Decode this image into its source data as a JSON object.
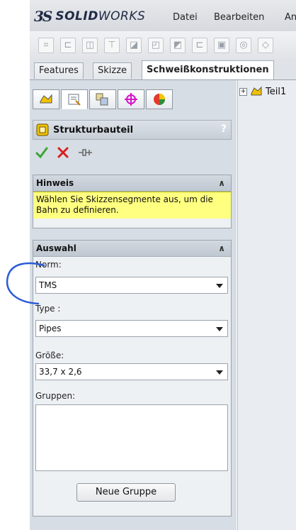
{
  "app": {
    "logo_prefix": "3S",
    "logo_name_bold": "SOLID",
    "logo_name_thin": "WORKS"
  },
  "menu": {
    "items": [
      "Datei",
      "Bearbeiten",
      "An"
    ]
  },
  "tabs": [
    {
      "label": "Features",
      "active": false
    },
    {
      "label": "Skizze",
      "active": false
    },
    {
      "label": "Schweißkonstruktionen",
      "active": true
    }
  ],
  "property_manager": {
    "title": "Strukturbauteil",
    "help": "?",
    "hint_group": {
      "title": "Hinweis",
      "text": "Wählen Sie Skizzensegmente aus, um die Bahn zu definieren."
    },
    "selection_group": {
      "title": "Auswahl",
      "norm_label": "Norm:",
      "norm_value": "TMS",
      "type_label": "Type :",
      "type_value": "Pipes",
      "size_label": "Größe:",
      "size_value": "33,7 x 2,6",
      "groups_label": "Gruppen:",
      "new_group_button": "Neue Gruppe"
    }
  },
  "feature_tree": {
    "root_label": "Teil1"
  },
  "colors": {
    "hint_background": "#ffff80",
    "panel_background": "#d7dde4",
    "annotation_stroke": "#2a5bd7"
  }
}
